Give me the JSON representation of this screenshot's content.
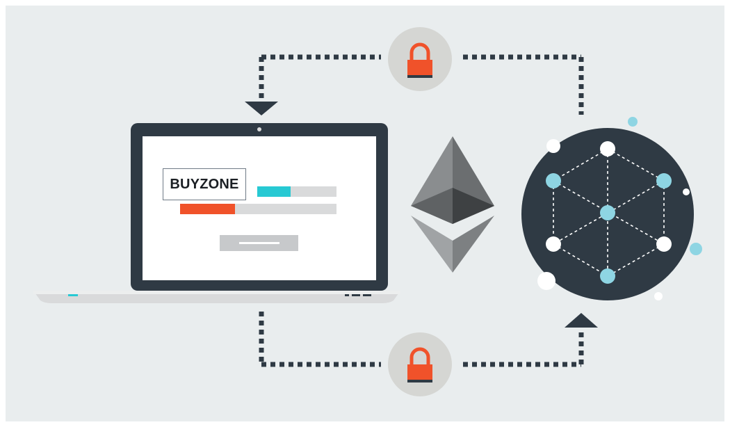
{
  "screen": {
    "brand_label": "BUYZONE"
  },
  "colors": {
    "background": "#e9edee",
    "frame_border": "#ffffff",
    "dark_navy": "#2f3a44",
    "accent_orange": "#f0522a",
    "accent_cyan": "#27c9d3",
    "light_gray": "#d9dadb",
    "node_blue": "#8ed5e3",
    "lock_circle": "#d5d6d3"
  },
  "icons": {
    "top_lock": "padlock-icon",
    "bottom_lock": "padlock-icon",
    "ethereum": "ethereum-logo",
    "network": "blockchain-network-icon",
    "laptop": "laptop-icon",
    "arrow_down": "arrow-down-icon",
    "arrow_up": "arrow-up-icon"
  }
}
